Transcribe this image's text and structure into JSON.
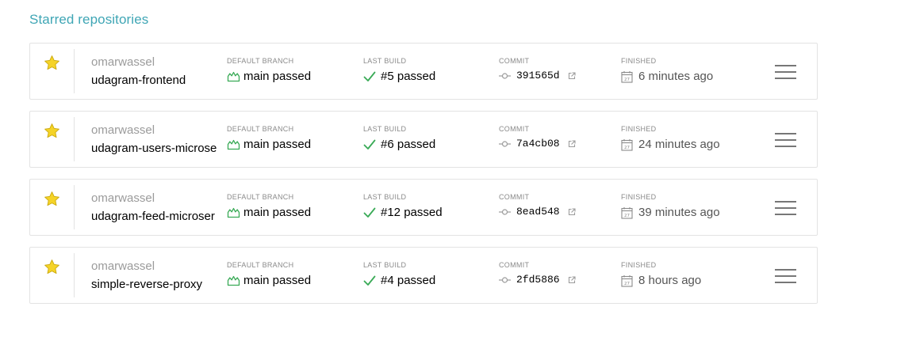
{
  "section": {
    "title": "Starred repositories"
  },
  "column_labels": {
    "branch": "DEFAULT BRANCH",
    "build": "LAST BUILD",
    "commit": "COMMIT",
    "finished": "FINISHED"
  },
  "icons": {
    "star": "star-icon",
    "branch": "branch-icon",
    "build": "check-icon",
    "commit": "commit-icon",
    "external": "external-link-icon",
    "finished": "calendar-icon",
    "menu": "hamburger-menu-icon"
  },
  "colors": {
    "title": "#3fa6b5",
    "passed": "#39aa56",
    "star": "#f5d327",
    "border": "#e3e3e3",
    "muted": "#9b9b9b",
    "text": "#555555"
  },
  "repos": [
    {
      "owner": "omarwassel",
      "name": "udagram-frontend",
      "branch": "main passed",
      "build": "#5 passed",
      "commit": "391565d",
      "finished": "6 minutes ago"
    },
    {
      "owner": "omarwassel",
      "name": "udagram-users-microse",
      "branch": "main passed",
      "build": "#6 passed",
      "commit": "7a4cb08",
      "finished": "24 minutes ago"
    },
    {
      "owner": "omarwassel",
      "name": "udagram-feed-microser",
      "branch": "main passed",
      "build": "#12 passed",
      "commit": "8ead548",
      "finished": "39 minutes ago"
    },
    {
      "owner": "omarwassel",
      "name": "simple-reverse-proxy",
      "branch": "main passed",
      "build": "#4 passed",
      "commit": "2fd5886",
      "finished": "8 hours ago"
    }
  ]
}
